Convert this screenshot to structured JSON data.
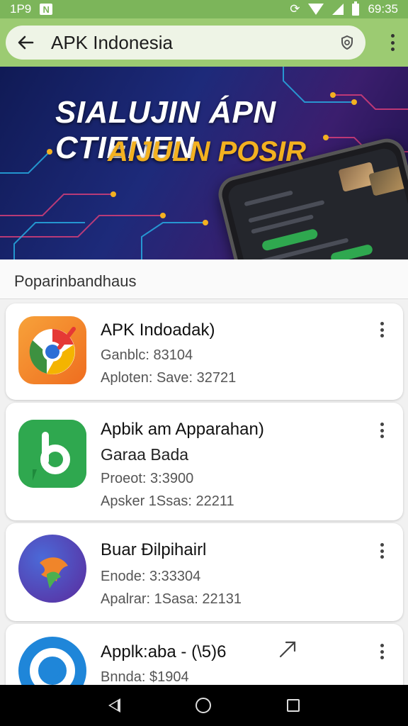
{
  "status_bar": {
    "left_text": "1P9",
    "box_glyph": "N",
    "time": "69:35",
    "icons": [
      "notification-icon",
      "wifi-icon",
      "signal-icon",
      "battery-icon"
    ]
  },
  "app_bar": {
    "title": "APK Indonesia",
    "back_icon": "arrow-left-icon",
    "right_icon": "shield-icon",
    "menu_icon": "more-vertical-icon",
    "accent_color": "#9ccb72"
  },
  "banner": {
    "line1": "SIALUJIN ÁPN CTIENEN",
    "line2": "AIJULN POSIR",
    "line1_color": "#ffffff",
    "line2_color": "#f3b120"
  },
  "section": {
    "label": "Poparinbandhaus"
  },
  "apps": [
    {
      "title": "APK Indoadak)",
      "line1": "Ganblc: 83104",
      "line2": "Aploten: Save: 32721",
      "icon": "chrome-like-icon"
    },
    {
      "title": "Apbik am Apparahan)",
      "subtitle": "Garaa Bada",
      "line1": "Proeot: 3:3900",
      "line2": "Apsker 1Ssas: 22211",
      "icon": "green-chat-b-icon"
    },
    {
      "title": "Buar Đilpihairl",
      "line1": "Enode: 3:33304",
      "line2": "Apalrar: 1Sasa: 22131",
      "icon": "purple-bird-icon"
    },
    {
      "title": "Applk:aba - (\\5)6",
      "line1": "Bnnda: $1904",
      "icon": "blue-ring-icon",
      "action_icon": "arrow-up-right-icon"
    }
  ],
  "nav_bar": {
    "icons": [
      "nav-back-icon",
      "nav-home-icon",
      "nav-recents-icon"
    ]
  }
}
